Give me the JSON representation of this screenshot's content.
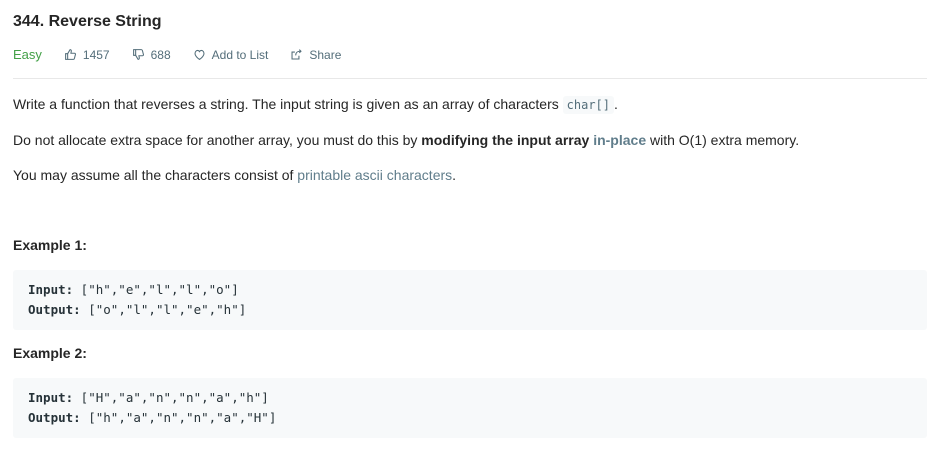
{
  "problem": {
    "title": "344. Reverse String",
    "difficulty": "Easy",
    "likes": "1457",
    "dislikes": "688",
    "add_to_list": "Add to List",
    "share": "Share"
  },
  "description": {
    "p1_text": "Write a function that reverses a string. The input string is given as an array of characters ",
    "p1_code": "char[]",
    "p1_end": ".",
    "p2_start": "Do not allocate extra space for another array, you must do this by ",
    "p2_bold": "modifying the input array",
    "p2_link": "in-place",
    "p2_end": " with O(1) extra memory.",
    "p3_start": "You may assume all the characters consist of ",
    "p3_link": "printable ascii characters",
    "p3_end": "."
  },
  "examples": [
    {
      "title": "Example 1:",
      "input_label": "Input:",
      "input_value": " [\"h\",\"e\",\"l\",\"l\",\"o\"]",
      "output_label": "Output:",
      "output_value": " [\"o\",\"l\",\"l\",\"e\",\"h\"]"
    },
    {
      "title": "Example 2:",
      "input_label": "Input:",
      "input_value": " [\"H\",\"a\",\"n\",\"n\",\"a\",\"h\"]",
      "output_label": "Output:",
      "output_value": " [\"h\",\"a\",\"n\",\"n\",\"a\",\"H\"]"
    }
  ],
  "colors": {
    "difficulty_easy": "#43a047",
    "link": "#607d8b",
    "code_bg": "#f7f9fa"
  }
}
